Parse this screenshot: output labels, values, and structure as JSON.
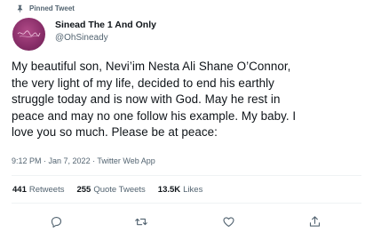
{
  "pinned": {
    "label": "Pinned Tweet"
  },
  "author": {
    "display_name": "Sinead The 1 And Only",
    "handle": "@OhSineady"
  },
  "tweet": {
    "text": "My beautiful son, Nevi’im Nesta Ali Shane O’Connor,\nthe very light of my life, decided to end his earthly\nstruggle today and is now with God. May he rest in\npeace and may no one follow his example.  My baby. I\nlove you so much. Please be at peace:"
  },
  "meta": {
    "time": "9:12 PM",
    "sep1": " · ",
    "date": "Jan 7, 2022",
    "sep2": " · ",
    "source": "Twitter Web App"
  },
  "stats": {
    "retweets_count": "441",
    "retweets_label": "Retweets",
    "quotes_count": "255",
    "quotes_label": "Quote Tweets",
    "likes_count": "13.5K",
    "likes_label": "Likes"
  },
  "colors": {
    "text": "#0f1419",
    "secondary": "#536471",
    "divider": "#eff3f4",
    "avatar": "#8a2f6a"
  },
  "icons": {
    "pin": "pin-icon",
    "reply": "reply-icon",
    "retweet": "retweet-icon",
    "like": "heart-icon",
    "share": "share-icon"
  }
}
